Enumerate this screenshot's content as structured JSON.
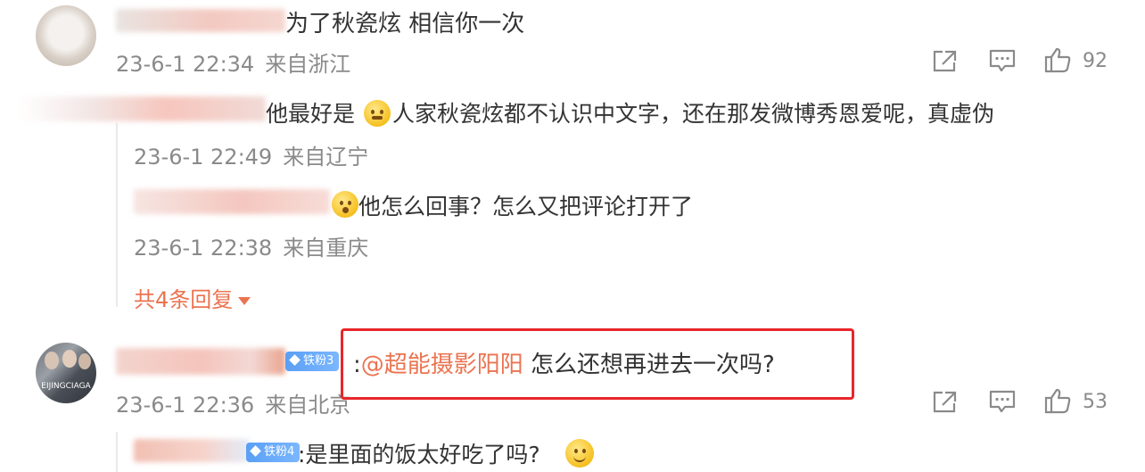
{
  "comments": [
    {
      "text": "为了秋瓷炫 相信你一次",
      "date": "23-6-1 22:34",
      "location": "来自浙江",
      "likes": "92",
      "replies": [
        {
          "prefix": "他最好是",
          "text": "人家秋瓷炫都不认识中文字，还在那发微博秀恩爱呢，真虚伪",
          "date": "23-6-1 22:49",
          "location": "来自辽宁"
        },
        {
          "text": "他怎么回事？怎么又把评论打开了",
          "date": "23-6-1 22:38",
          "location": "来自重庆"
        }
      ],
      "more_replies": "共4条回复"
    },
    {
      "badge": "铁粉3",
      "colon": ":",
      "mention": "@超能摄影阳阳",
      "text": " 怎么还想再进去一次吗?",
      "date": "23-6-1 22:36",
      "location": "来自北京",
      "likes": "53",
      "replies": [
        {
          "badge": "铁粉4",
          "text": ":是里面的饭太好吃了吗?"
        }
      ]
    }
  ],
  "colors": {
    "accent": "#eb7350",
    "highlight_border": "#e8262b",
    "meta_text": "#8a8a8a"
  },
  "icons": [
    "share-icon",
    "comment-icon",
    "thumbs-up-icon",
    "emoji-icon",
    "caret-down-icon",
    "diamond-icon"
  ]
}
